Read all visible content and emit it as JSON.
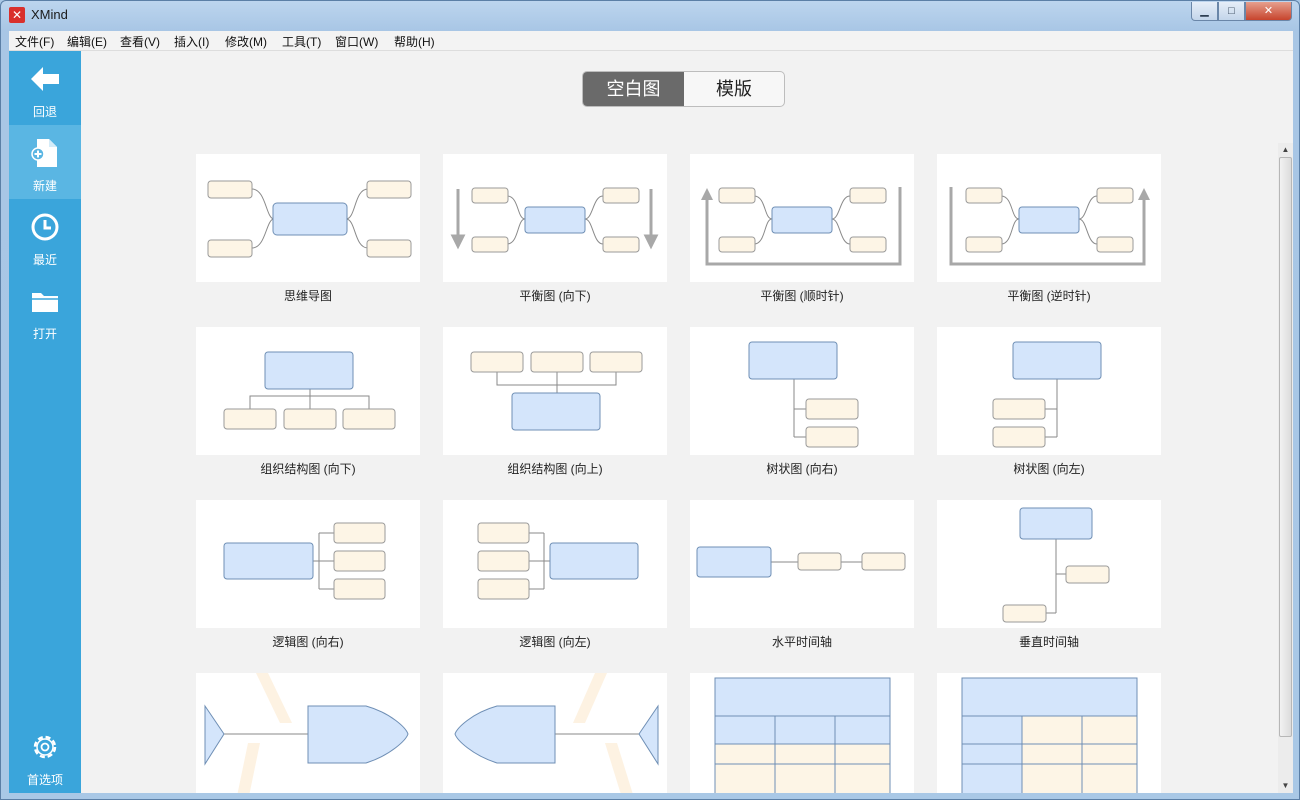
{
  "window": {
    "title": "XMind",
    "app_icon": "xmind-logo-icon"
  },
  "menu": [
    "文件(F)",
    "编辑(E)",
    "查看(V)",
    "插入(I)",
    "修改(M)",
    "工具(T)",
    "窗口(W)",
    "帮助(H)"
  ],
  "sidebar": {
    "items": [
      {
        "label": "回退",
        "icon": "back-arrow-icon"
      },
      {
        "label": "新建",
        "icon": "new-file-icon"
      },
      {
        "label": "最近",
        "icon": "clock-icon"
      },
      {
        "label": "打开",
        "icon": "folder-icon"
      }
    ],
    "bottom": {
      "label": "首选项",
      "icon": "gear-icon"
    }
  },
  "tabs": {
    "blank": "空白图",
    "template": "模版"
  },
  "templates": [
    {
      "label": "思维导图"
    },
    {
      "label": "平衡图 (向下)"
    },
    {
      "label": "平衡图 (顺时针)"
    },
    {
      "label": "平衡图 (逆时针)"
    },
    {
      "label": "组织结构图 (向下)"
    },
    {
      "label": "组织结构图 (向上)"
    },
    {
      "label": "树状图 (向右)"
    },
    {
      "label": "树状图 (向左)"
    },
    {
      "label": "逻辑图 (向右)"
    },
    {
      "label": "逻辑图 (向左)"
    },
    {
      "label": "水平时间轴"
    },
    {
      "label": "垂直时间轴"
    },
    {
      "label": ""
    },
    {
      "label": ""
    },
    {
      "label": ""
    },
    {
      "label": ""
    }
  ],
  "colors": {
    "sidebar": "#3aa5db",
    "central_topic": "#d4e5fb",
    "subtopic": "#fdf5e6",
    "tab_active": "#6a6a6a"
  }
}
